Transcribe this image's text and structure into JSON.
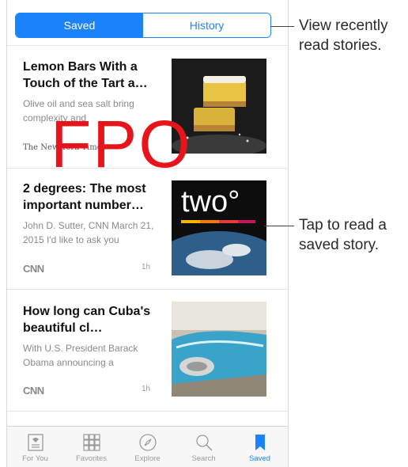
{
  "segment": {
    "saved": "Saved",
    "history": "History"
  },
  "stories": [
    {
      "title": "Lemon Bars With a Touch of the Tart a…",
      "snippet": "Olive oil and sea salt bring complexity and",
      "source": "The New York Times",
      "age": ""
    },
    {
      "title": "2 degrees: The most important number…",
      "snippet": "John D. Sutter, CNN March 21, 2015 I'd like to ask you",
      "source": "CNN",
      "age": "1h",
      "thumb_text": "two°"
    },
    {
      "title": "How long can Cuba's beautiful cl…",
      "snippet": "With U.S. President Barack Obama announcing a",
      "source": "CNN",
      "age": "1h"
    }
  ],
  "overlay_text": "FPO",
  "tabs": [
    {
      "label": "For You",
      "icon": "for-you-icon"
    },
    {
      "label": "Favorites",
      "icon": "favorites-grid-icon"
    },
    {
      "label": "Explore",
      "icon": "compass-icon"
    },
    {
      "label": "Search",
      "icon": "search-icon"
    },
    {
      "label": "Saved",
      "icon": "bookmark-icon"
    }
  ],
  "callouts": {
    "history": "View recently read stories.",
    "saved_story": "Tap to read a saved story."
  },
  "colors": {
    "accent": "#1a82fb",
    "fpo": "#e8141c"
  }
}
